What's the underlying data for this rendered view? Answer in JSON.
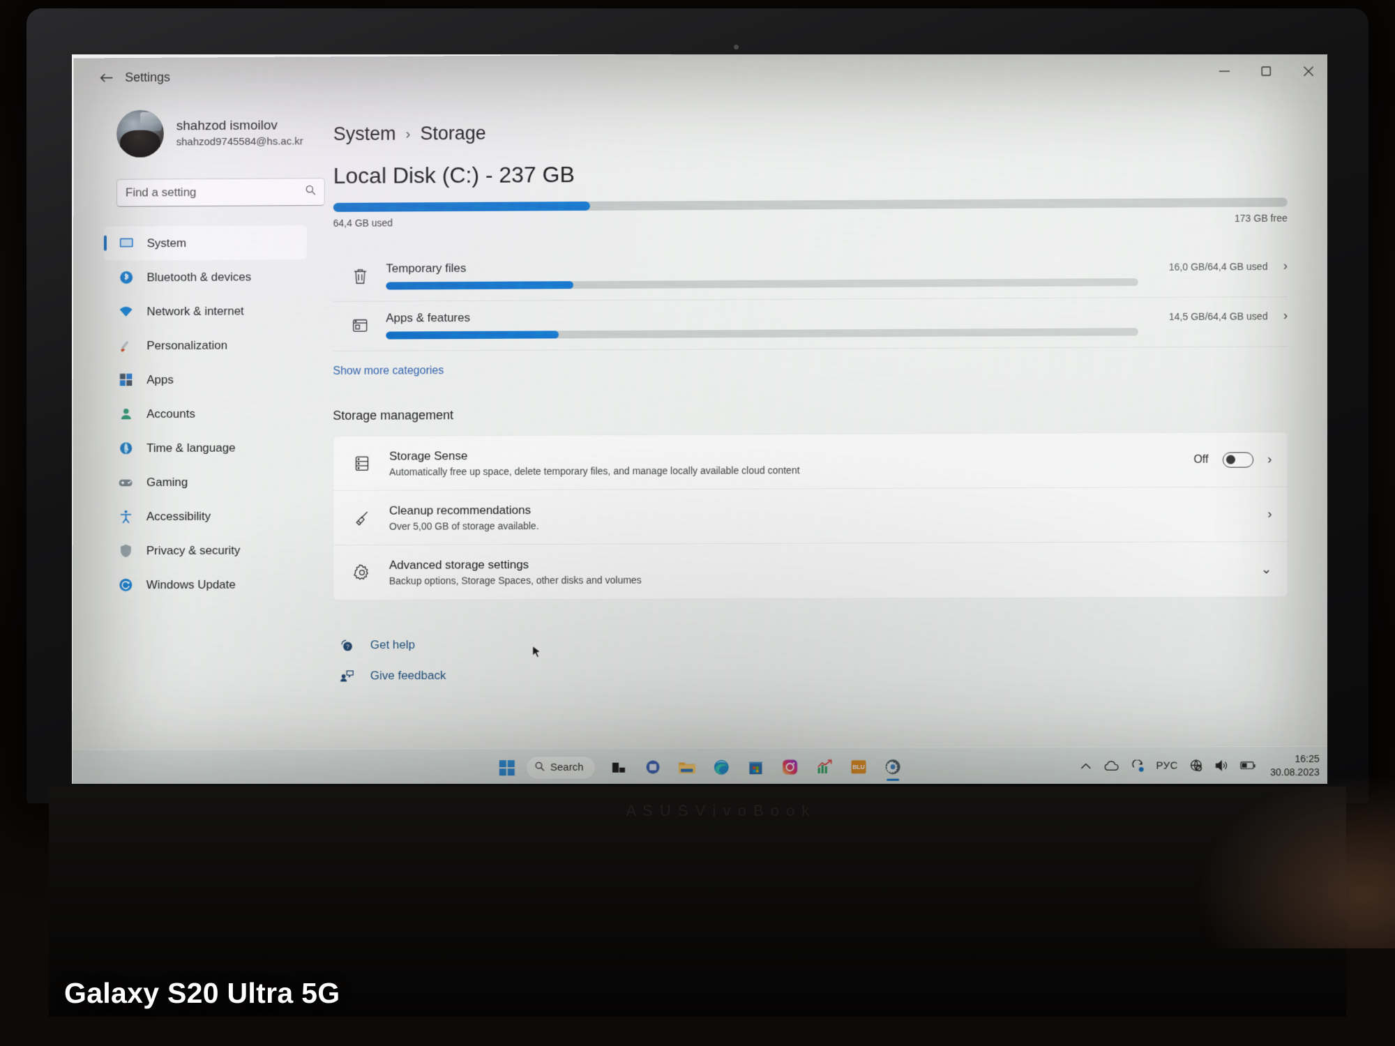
{
  "window": {
    "app_title": "Settings",
    "back_icon": "back-arrow-icon",
    "minimize": "–",
    "maximize": "❐",
    "close": "✕"
  },
  "account": {
    "name": "shahzod ismoilov",
    "email": "shahzod9745584@hs.ac.kr",
    "avatar_icon": "user-avatar-photo"
  },
  "search": {
    "placeholder": "Find a setting",
    "icon": "search-icon"
  },
  "sidebar": {
    "items": [
      {
        "label": "System",
        "icon": "monitor-icon",
        "selected": true
      },
      {
        "label": "Bluetooth & devices",
        "icon": "bluetooth-icon",
        "selected": false
      },
      {
        "label": "Network & internet",
        "icon": "wifi-icon",
        "selected": false
      },
      {
        "label": "Personalization",
        "icon": "paintbrush-icon",
        "selected": false
      },
      {
        "label": "Apps",
        "icon": "apps-grid-icon",
        "selected": false
      },
      {
        "label": "Accounts",
        "icon": "person-icon",
        "selected": false
      },
      {
        "label": "Time & language",
        "icon": "clock-globe-icon",
        "selected": false
      },
      {
        "label": "Gaming",
        "icon": "gamepad-icon",
        "selected": false
      },
      {
        "label": "Accessibility",
        "icon": "accessibility-person-icon",
        "selected": false
      },
      {
        "label": "Privacy & security",
        "icon": "shield-icon",
        "selected": false
      },
      {
        "label": "Windows Update",
        "icon": "refresh-circle-icon",
        "selected": false
      }
    ]
  },
  "main": {
    "breadcrumb": {
      "parent": "System",
      "separator": "›",
      "current": "Storage"
    },
    "disk": {
      "title": "Local Disk (C:) - 237 GB",
      "used_label": "64,4 GB used",
      "free_label": "173 GB free",
      "used_percent": 27
    },
    "categories": [
      {
        "name": "Temporary files",
        "icon": "trash-can-icon",
        "usage": "16,0 GB/64,4 GB used",
        "percent": 25,
        "chevron": "›"
      },
      {
        "name": "Apps & features",
        "icon": "app-window-icon",
        "usage": "14,5 GB/64,4 GB used",
        "percent": 23,
        "chevron": "›"
      }
    ],
    "show_more": "Show more categories",
    "storage_management_heading": "Storage management",
    "management_rows": [
      {
        "title": "Storage Sense",
        "subtitle": "Automatically free up space, delete temporary files, and manage locally available cloud content",
        "icon": "server-drive-icon",
        "toggle_label": "Off",
        "toggle_on": false,
        "chevron": "›"
      },
      {
        "title": "Cleanup recommendations",
        "subtitle": "Over 5,00 GB of storage available.",
        "icon": "broom-icon",
        "chevron": "›"
      },
      {
        "title": "Advanced storage settings",
        "subtitle": "Backup options, Storage Spaces, other disks and volumes",
        "icon": "gear-icon",
        "chevron": "⌄"
      }
    ],
    "help_links": [
      {
        "label": "Get help",
        "icon": "help-question-icon"
      },
      {
        "label": "Give feedback",
        "icon": "feedback-person-icon"
      }
    ]
  },
  "taskbar": {
    "start_icon": "windows-start-icon",
    "search_label": "Search",
    "search_icon": "search-icon",
    "items": [
      {
        "name": "task-view-icon"
      },
      {
        "name": "chat-teams-icon"
      },
      {
        "name": "file-explorer-icon"
      },
      {
        "name": "edge-browser-icon"
      },
      {
        "name": "microsoft-store-icon"
      },
      {
        "name": "instagram-icon"
      },
      {
        "name": "stocks-chart-icon"
      },
      {
        "name": "blu-app-icon",
        "label": "BLU"
      },
      {
        "name": "settings-gear-icon",
        "active": true
      }
    ],
    "tray": {
      "chevron_up": "⌃",
      "onedrive_icon": "cloud-icon",
      "update_icon": "update-refresh-icon",
      "language": "РУС",
      "network_icon": "globe-blocked-icon",
      "volume_icon": "speaker-icon",
      "battery_icon": "battery-icon"
    },
    "clock": {
      "time": "16:25",
      "date": "30.08.2023"
    }
  },
  "photo": {
    "watermark": "Galaxy S20 Ultra 5G",
    "deck_reflection": "A S U S   V i v o B o o k"
  }
}
